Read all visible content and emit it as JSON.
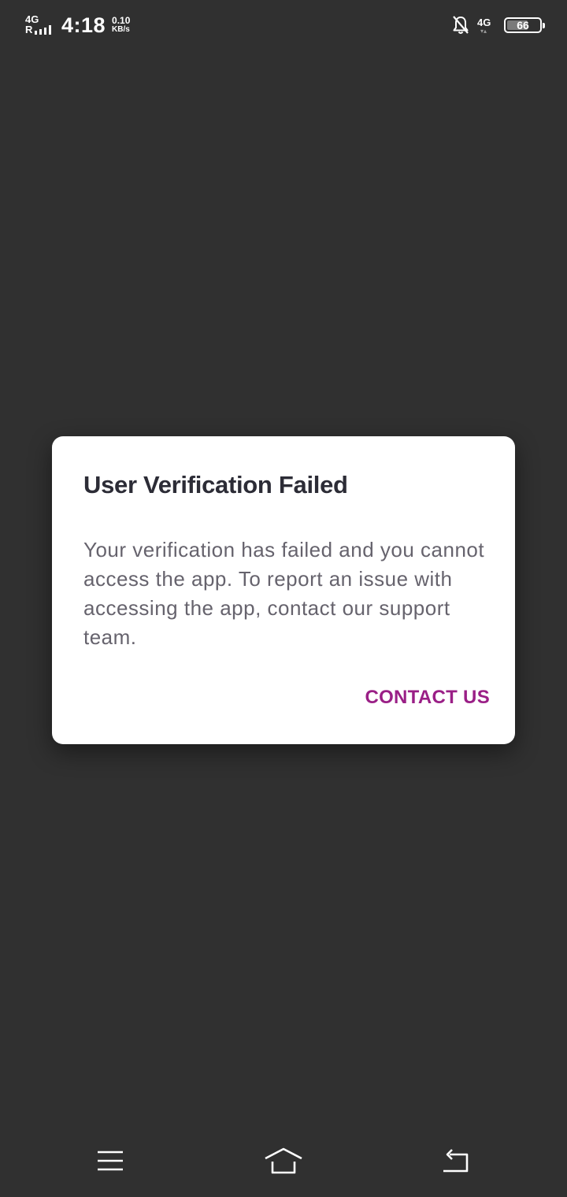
{
  "status_bar": {
    "network_left": "4G",
    "roaming": "R",
    "time": "4:18",
    "speed_value": "0.10",
    "speed_unit": "KB/s",
    "network_right": "4G",
    "battery": "66",
    "battery_level": 0.66,
    "icons": [
      "signal-icon",
      "bell-off-icon",
      "battery-icon"
    ]
  },
  "dialog": {
    "title": "User Verification Failed",
    "message": "Your verification has failed and you cannot access the app. To report an issue with accessing the app, contact our support team.",
    "action_label": "CONTACT US",
    "action_color": "#9a1f86"
  },
  "nav_bar": {
    "icons": [
      "menu-icon",
      "home-icon",
      "back-icon"
    ]
  }
}
